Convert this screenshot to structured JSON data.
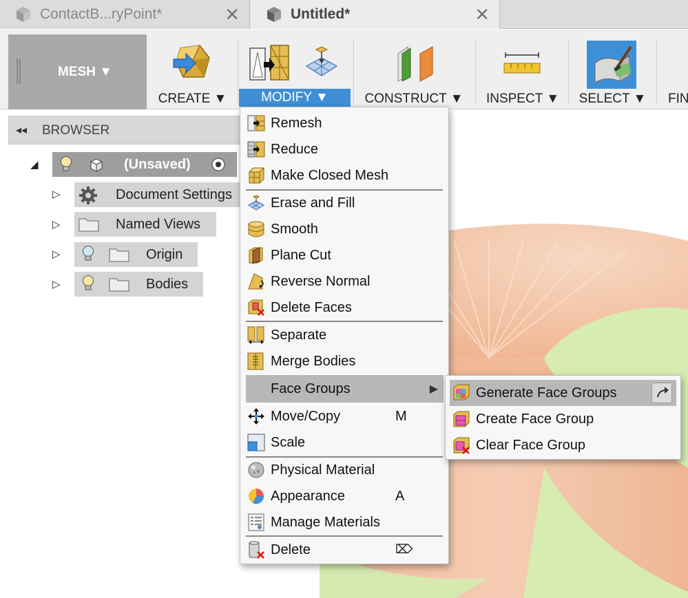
{
  "tabs": [
    {
      "label": "ContactB...ryPoint*",
      "close": "✕",
      "active": false
    },
    {
      "label": "Untitled*",
      "close": "✕",
      "active": true
    }
  ],
  "workspace": {
    "label": "MESH ▼"
  },
  "toolbar": {
    "create": "CREATE ▼",
    "modify": "MODIFY ▼",
    "construct": "CONSTRUCT ▼",
    "inspect": "INSPECT ▼",
    "select": "SELECT ▼",
    "finish": "FIN"
  },
  "browser": {
    "collapse": "◂◂",
    "title": "BROWSER",
    "root": {
      "label": "(Unsaved)"
    },
    "items": [
      {
        "label": "Document Settings",
        "icon": "gear-icon"
      },
      {
        "label": "Named Views",
        "icon": "folder-icon"
      },
      {
        "label": "Origin",
        "icon": "folder-icon"
      },
      {
        "label": "Bodies",
        "icon": "folder-icon"
      }
    ]
  },
  "modify_menu": {
    "items": [
      {
        "label": "Remesh",
        "icon": "remesh-icon"
      },
      {
        "label": "Reduce",
        "icon": "reduce-icon"
      },
      {
        "label": "Make Closed Mesh",
        "icon": "make-closed-mesh-icon"
      },
      {
        "label": "Erase and Fill",
        "icon": "erase-fill-icon"
      },
      {
        "label": "Smooth",
        "icon": "smooth-icon"
      },
      {
        "label": "Plane Cut",
        "icon": "plane-cut-icon"
      },
      {
        "label": "Reverse Normal",
        "icon": "reverse-normal-icon"
      },
      {
        "label": "Delete Faces",
        "icon": "delete-faces-icon"
      },
      {
        "label": "Separate",
        "icon": "separate-icon"
      },
      {
        "label": "Merge Bodies",
        "icon": "merge-bodies-icon"
      },
      {
        "label": "Face Groups",
        "icon": "",
        "submenu_arrow": "▶"
      },
      {
        "label": "Move/Copy",
        "icon": "move-icon",
        "shortcut": "M"
      },
      {
        "label": "Scale",
        "icon": "scale-icon"
      },
      {
        "label": "Physical Material",
        "icon": "physical-material-icon"
      },
      {
        "label": "Appearance",
        "icon": "appearance-icon",
        "shortcut": "A"
      },
      {
        "label": "Manage Materials",
        "icon": "manage-materials-icon"
      },
      {
        "label": "Delete",
        "icon": "delete-icon",
        "shortcut": "⌦"
      }
    ]
  },
  "face_groups_submenu": {
    "items": [
      {
        "label": "Generate Face Groups",
        "icon": "generate-face-groups-icon"
      },
      {
        "label": "Create Face Group",
        "icon": "create-face-group-icon"
      },
      {
        "label": "Clear Face Group",
        "icon": "clear-face-group-icon"
      }
    ]
  },
  "colors": {
    "accent": "#3f8fd6",
    "highlight": "#b8b8b8",
    "mesh_top": "#f4c6a6",
    "mesh_side": "#f2c3a8",
    "plane": "#d7ecb0"
  }
}
